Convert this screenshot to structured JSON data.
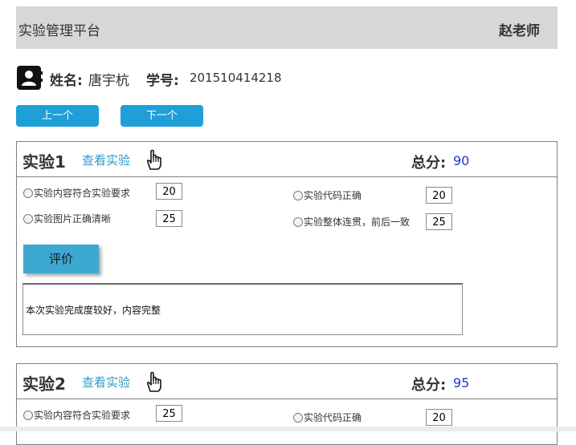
{
  "header": {
    "app_title": "实验管理平台",
    "user_name": "赵老师"
  },
  "student": {
    "name_label": "姓名:",
    "name": "唐宇杭",
    "id_label": "学号:",
    "id": "201510414218"
  },
  "nav": {
    "prev_label": "上一个",
    "next_label": "下一个"
  },
  "experiments": [
    {
      "title": "实验1",
      "view_label": "查看实验",
      "total_label": "总分:",
      "total": "90",
      "criteria": [
        {
          "label": "实验内容符合实验要求",
          "score": "20"
        },
        {
          "label": "实验代码正确",
          "score": "20"
        },
        {
          "label": "实验图片正确清晰",
          "score": "25"
        },
        {
          "label": "实验整体连贯，前后一致",
          "score": "25"
        }
      ],
      "rate_label": "评价",
      "comment": "本次实验完成度较好，内容完整"
    },
    {
      "title": "实验2",
      "view_label": "查看实验",
      "total_label": "总分:",
      "total": "95",
      "criteria": [
        {
          "label": "实验内容符合实验要求",
          "score": "25"
        },
        {
          "label": "实验代码正确",
          "score": "20"
        }
      ]
    }
  ],
  "colors": {
    "nav_button": "#1e9fd8",
    "link": "#2f9bc7",
    "total_value": "#1a3ec9",
    "header_bg": "#d7d7d7"
  },
  "icons": {
    "avatar": "user-avatar-icon",
    "hand": "hand-pointer-icon"
  }
}
